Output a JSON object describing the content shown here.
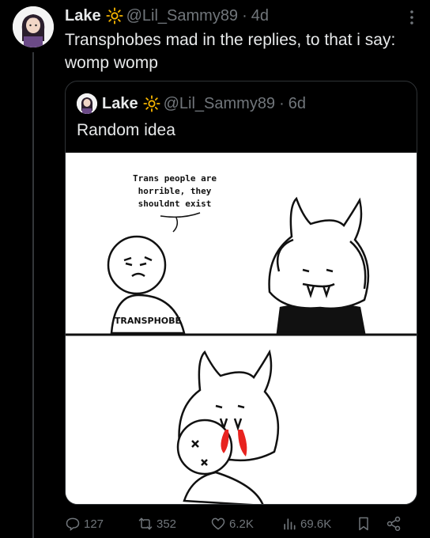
{
  "tweet": {
    "author_name": "Lake",
    "author_handle": "@Lil_Sammy89",
    "separator": "·",
    "time": "4d",
    "text": "Transphobes mad in the replies, to that i say:  womp womp"
  },
  "quoted_tweet": {
    "author_name": "Lake",
    "author_handle": "@Lil_Sammy89",
    "separator": "·",
    "time": "6d",
    "text": "Random idea",
    "comic": {
      "speech_bubble": [
        "Trans people are",
        "horrible, they",
        "shouldnt exist"
      ],
      "shirt_text": "TRANSPHOBE"
    }
  },
  "actions": {
    "replies": "127",
    "reposts": "352",
    "likes": "6.2K",
    "views": "69.6K"
  },
  "icons": [
    "more-icon",
    "sun-icon",
    "reply-icon",
    "repost-icon",
    "like-icon",
    "views-icon",
    "bookmark-icon",
    "share-icon"
  ],
  "colors": {
    "background": "#000000",
    "text": "#e7e9ea",
    "muted": "#71767b",
    "border": "#2f3336",
    "sun": "#f5b400"
  }
}
